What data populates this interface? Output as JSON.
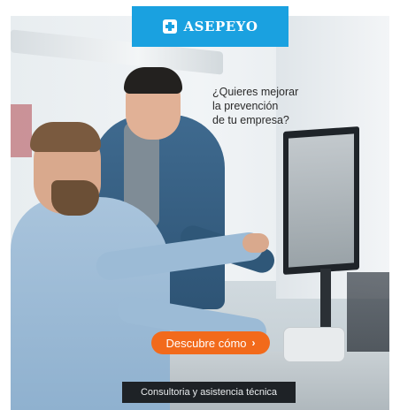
{
  "logo": {
    "text": "ASEPEYO",
    "icon": "cross-icon",
    "brand_color": "#1aa1e0"
  },
  "headline": {
    "lines": [
      "¿Quieres mejorar",
      "la prevención",
      "de tu empresa?"
    ]
  },
  "cta": {
    "label": "Descubre cómo",
    "chevron": "›",
    "color": "#f26a1b"
  },
  "tagline": "Consultoria y asistencia técnica"
}
